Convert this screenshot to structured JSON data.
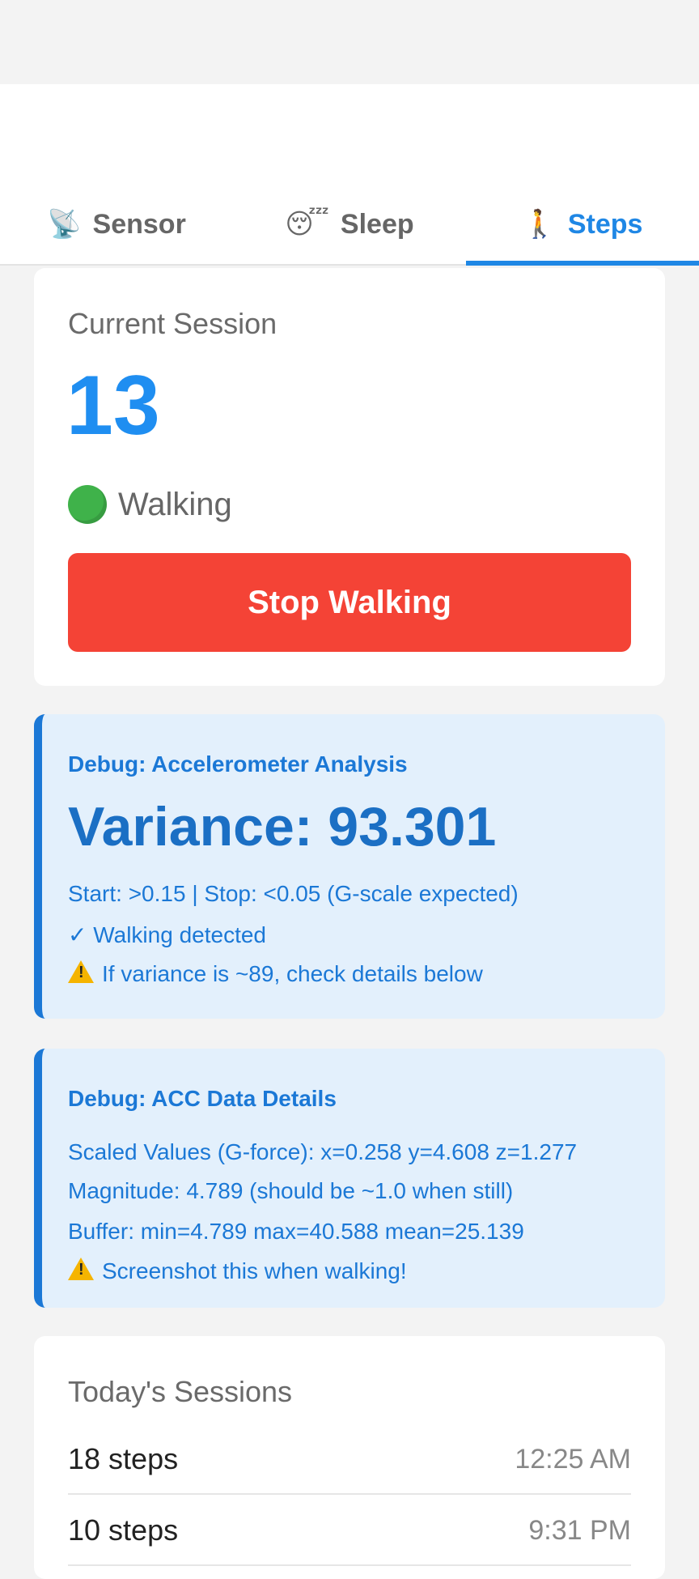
{
  "tabs": [
    {
      "icon": "📡",
      "label": "Sensor"
    },
    {
      "icon": "😴",
      "label": "Sleep"
    },
    {
      "icon": "🚶",
      "label": "Steps"
    }
  ],
  "session": {
    "title": "Current Session",
    "steps": "13",
    "status": "Walking",
    "stop_label": "Stop Walking"
  },
  "debug_analysis": {
    "title": "Debug: Accelerometer Analysis",
    "variance": "Variance: 93.301",
    "line1": "Start: >0.15 | Stop: <0.05 (G-scale expected)",
    "line2": "✓ Walking detected",
    "line3": "If variance is ~89, check details below"
  },
  "debug_details": {
    "title": "Debug: ACC Data Details",
    "line1": "Scaled Values (G-force): x=0.258 y=4.608 z=1.277",
    "line2": "Magnitude: 4.789 (should be ~1.0 when still)",
    "line3": "Buffer: min=4.789 max=40.588 mean=25.139",
    "line4": "Screenshot this when walking!"
  },
  "history": {
    "title": "Today's Sessions",
    "rows": [
      {
        "steps": "18 steps",
        "time": "12:25 AM"
      },
      {
        "steps": "10 steps",
        "time": "9:31 PM"
      }
    ]
  },
  "colors": {
    "accent": "#1f87e5",
    "stop": "#f44336",
    "debug_bg": "#e3f0fc",
    "status_dot": "#3fb24a"
  }
}
